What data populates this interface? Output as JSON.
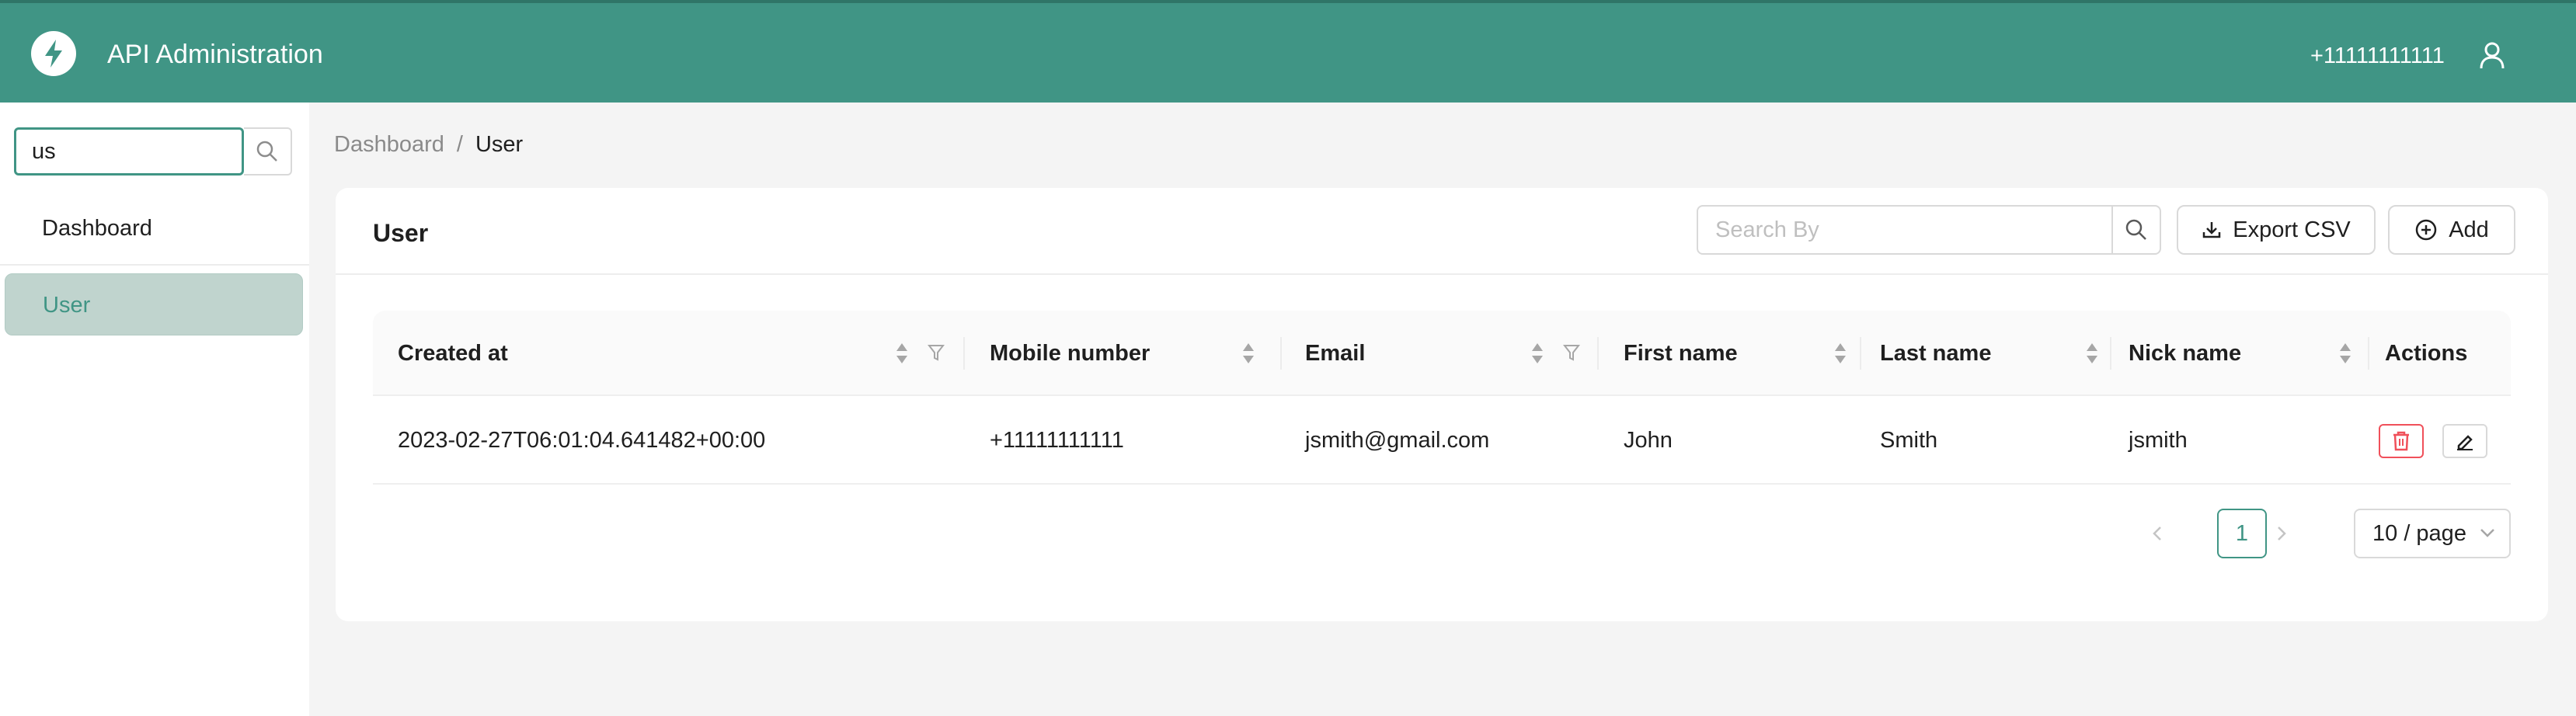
{
  "header": {
    "title": "API Administration",
    "user_phone": "+11111111111",
    "logo_icon": "lightning-bolt-icon",
    "user_icon": "user-icon"
  },
  "sidebar": {
    "search_value": "us",
    "items": [
      {
        "label": "Dashboard",
        "active": false
      },
      {
        "label": "User",
        "active": true
      }
    ]
  },
  "breadcrumb": {
    "items": [
      "Dashboard",
      "User"
    ],
    "separator": "/"
  },
  "card": {
    "title": "User",
    "search_placeholder": "Search By",
    "export_label": "Export CSV",
    "add_label": "Add"
  },
  "table": {
    "columns": [
      "Created at",
      "Mobile number",
      "Email",
      "First name",
      "Last name",
      "Nick name",
      "Actions"
    ],
    "rows": [
      {
        "created_at": "2023-02-27T06:01:04.641482+00:00",
        "mobile": "+11111111111",
        "email": "jsmith@gmail.com",
        "first_name": "John",
        "last_name": "Smith",
        "nick_name": "jsmith"
      }
    ]
  },
  "pagination": {
    "current_page": "1",
    "page_size": "10 / page"
  },
  "colors": {
    "primary": "#409585",
    "danger": "#f0505a",
    "active_menu_bg": "#c0d4ce"
  }
}
